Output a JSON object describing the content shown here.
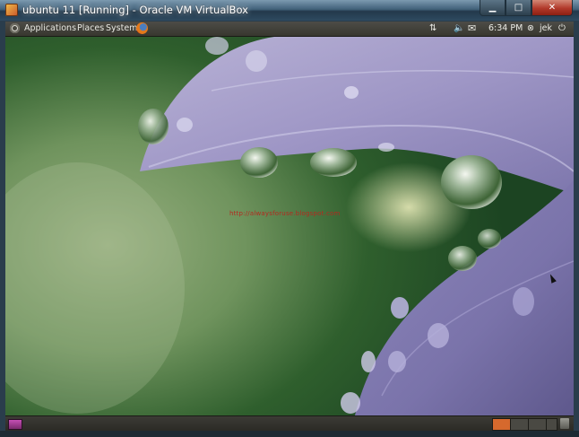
{
  "window": {
    "title": "ubuntu 11 [Running] - Oracle VM VirtualBox",
    "minimize_glyph": "▁",
    "maximize_glyph": "□",
    "close_glyph": "✕"
  },
  "top_panel": {
    "menus": [
      "Applications",
      "Places",
      "System"
    ],
    "tray": {
      "network_glyph": "⇅",
      "volume_glyph": "🔈",
      "mail_glyph": "✉",
      "clock": "6:34 PM",
      "user_glyph": "⊗",
      "user": "jek",
      "power_glyph": "⏻"
    }
  },
  "desktop": {
    "wallpaper": "purple petals with water drops on green background",
    "watermark": "http://alwaysforuse.blogspot.com"
  },
  "colors": {
    "panel": "#3f3e38",
    "workspace_active": "#d6692d",
    "watermark": "#b32a1f"
  },
  "icons": [
    "ubuntu-logo-icon",
    "firefox-icon",
    "network-icon",
    "volume-icon",
    "mail-icon",
    "user-icon",
    "power-icon",
    "show-desktop-icon",
    "trash-icon"
  ]
}
